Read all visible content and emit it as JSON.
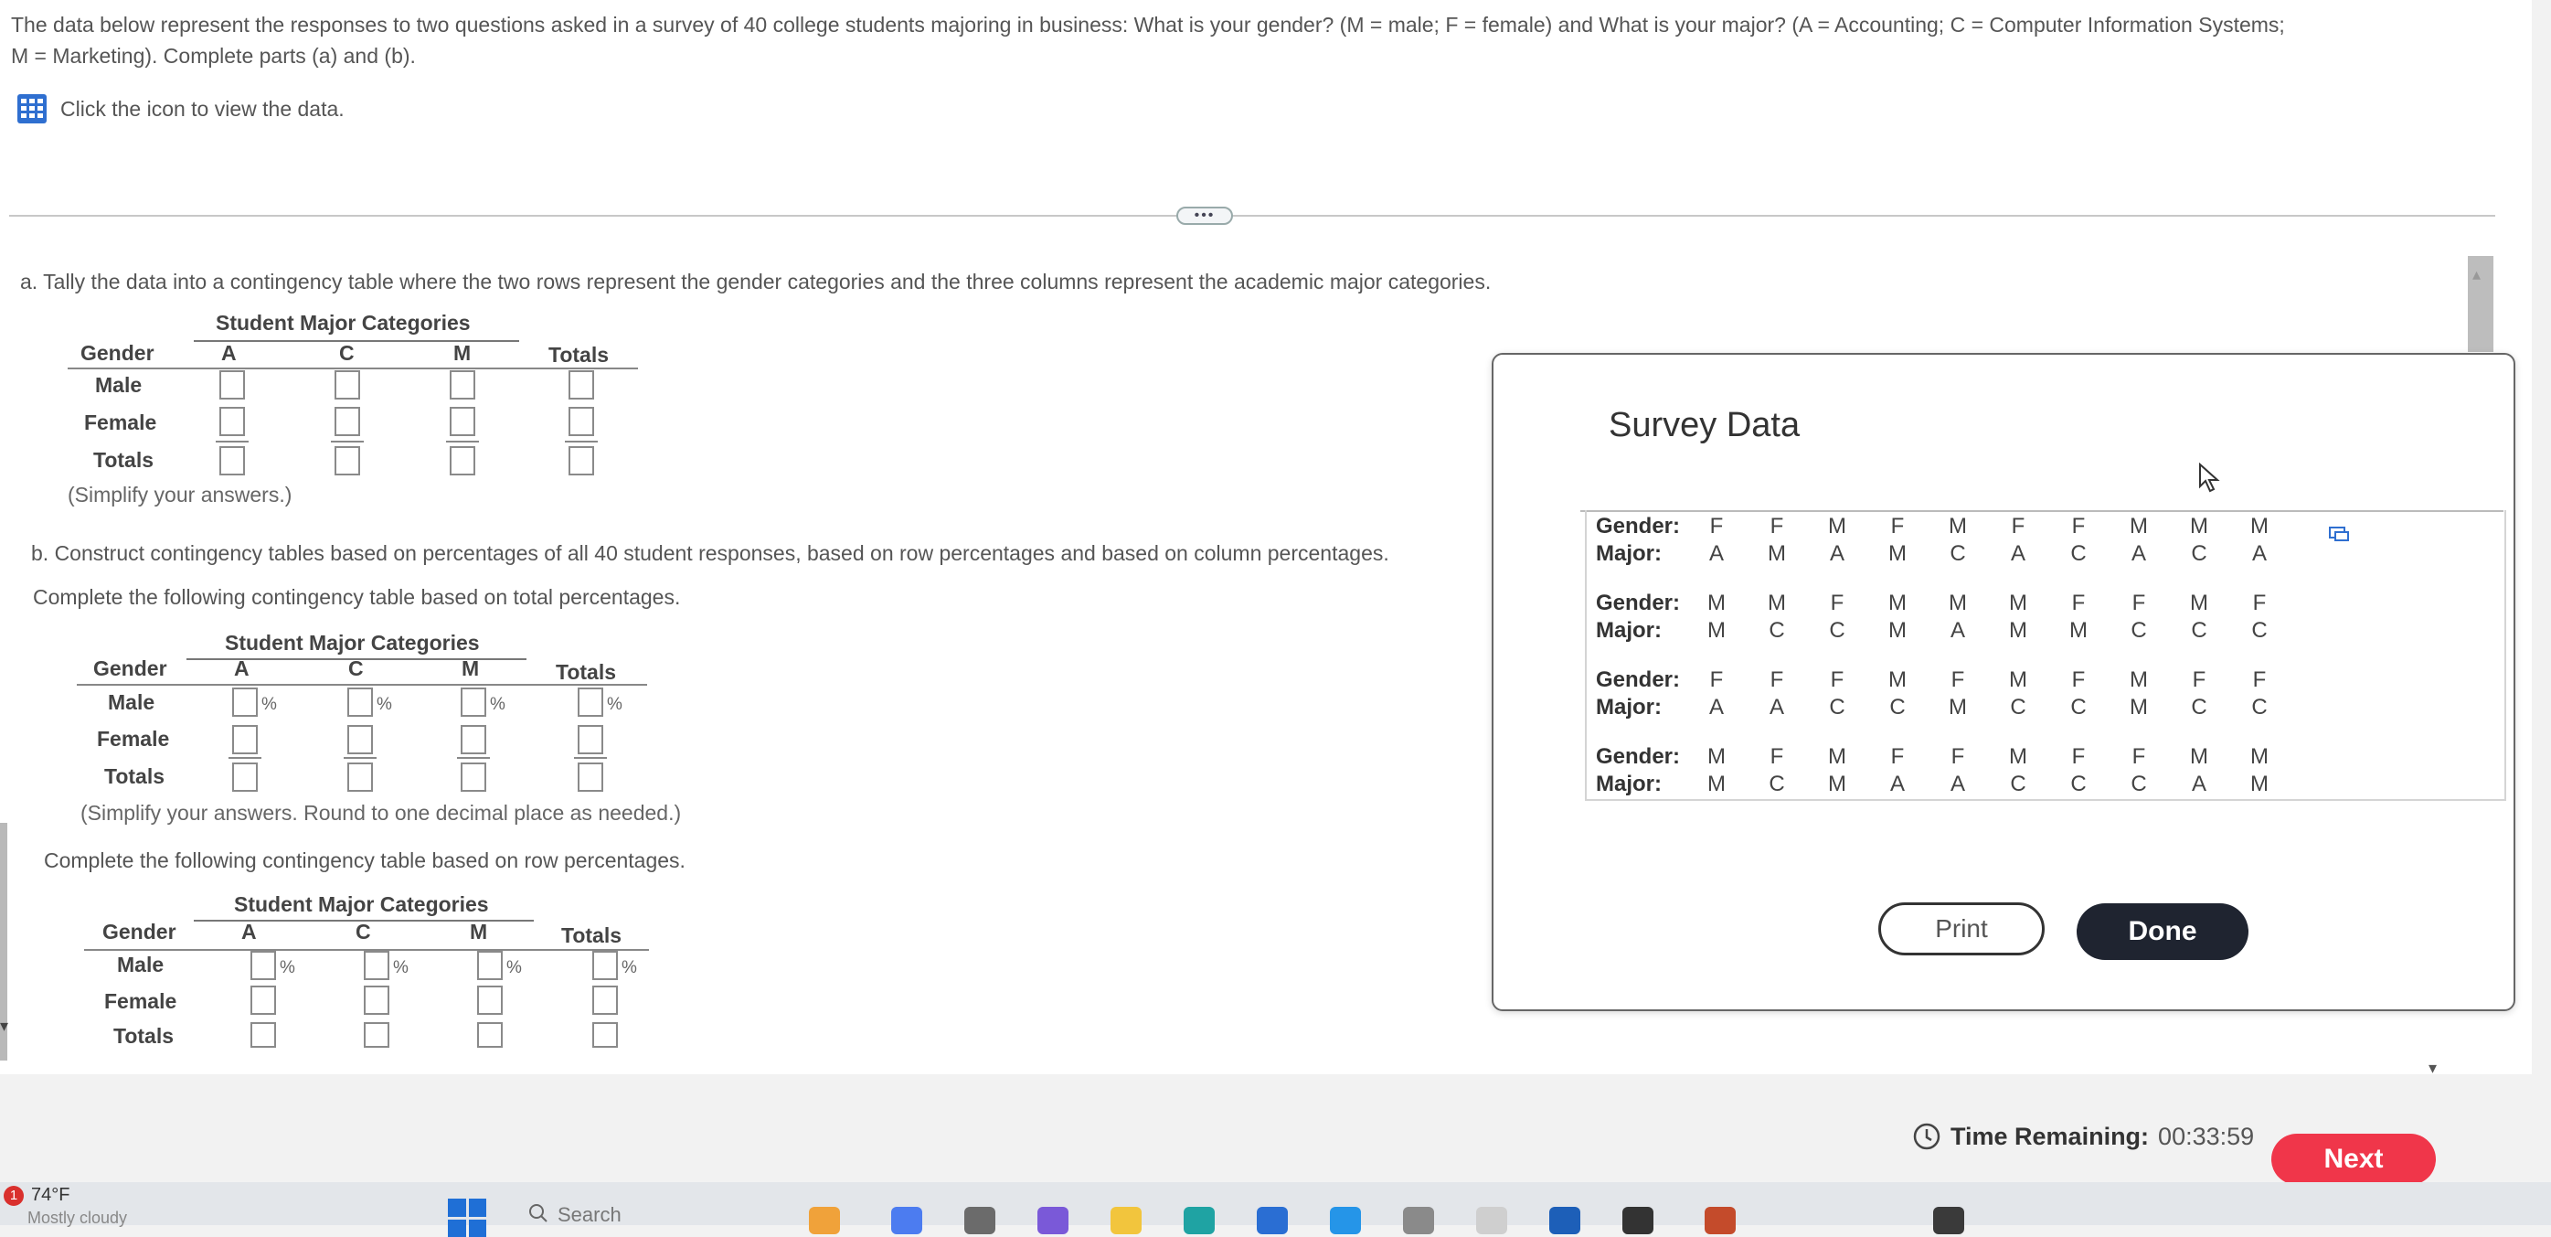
{
  "intro": {
    "line1": "The data below represent the responses to two questions asked in a survey of 40 college students majoring in business: What is your gender? (M = male; F = female) and What is your major? (A = Accounting; C = Computer Information Systems;",
    "line2": "M = Marketing). Complete parts (a) and (b)."
  },
  "data_link": "Click the icon to view the data.",
  "divider_handle": "•••",
  "part_a": {
    "question": "a. Tally the data into a contingency table where the two rows represent the gender categories and the three columns represent the academic major categories.",
    "note": "(Simplify your answers.)"
  },
  "part_b": {
    "question": "b. Construct contingency tables based on percentages of all 40 student responses, based on row percentages and based on column percentages.",
    "total_intro": "Complete the following contingency table based on total percentages.",
    "total_note": "(Simplify your answers. Round to one decimal place as needed.)",
    "row_intro": "Complete the following contingency table based on row percentages."
  },
  "table": {
    "caption": "Student Major Categories",
    "gender": "Gender",
    "cols": [
      "A",
      "C",
      "M"
    ],
    "totals": "Totals",
    "rows": [
      "Male",
      "Female",
      "Totals"
    ],
    "pct": "%"
  },
  "dialog": {
    "title": "Survey Data",
    "gender_label": "Gender:",
    "major_label": "Major:",
    "blocks": [
      {
        "gender": [
          "F",
          "F",
          "M",
          "F",
          "M",
          "F",
          "F",
          "M",
          "M",
          "M"
        ],
        "major": [
          "A",
          "M",
          "A",
          "M",
          "C",
          "A",
          "C",
          "A",
          "C",
          "A"
        ]
      },
      {
        "gender": [
          "M",
          "M",
          "F",
          "M",
          "M",
          "M",
          "F",
          "F",
          "M",
          "F"
        ],
        "major": [
          "M",
          "C",
          "C",
          "M",
          "A",
          "M",
          "M",
          "C",
          "C",
          "C"
        ]
      },
      {
        "gender": [
          "F",
          "F",
          "F",
          "M",
          "F",
          "M",
          "F",
          "M",
          "F",
          "F"
        ],
        "major": [
          "A",
          "A",
          "C",
          "C",
          "M",
          "C",
          "C",
          "M",
          "C",
          "C"
        ]
      },
      {
        "gender": [
          "M",
          "F",
          "M",
          "F",
          "F",
          "M",
          "F",
          "F",
          "M",
          "M"
        ],
        "major": [
          "M",
          "C",
          "M",
          "A",
          "A",
          "C",
          "C",
          "C",
          "A",
          "M"
        ]
      }
    ],
    "print": "Print",
    "done": "Done"
  },
  "footer": {
    "timer_label": "Time Remaining:",
    "timer_value": "00:33:59",
    "next": "Next"
  },
  "taskbar": {
    "badge": "1",
    "temp": "74°F",
    "weather": "Mostly cloudy",
    "search": "Search"
  }
}
